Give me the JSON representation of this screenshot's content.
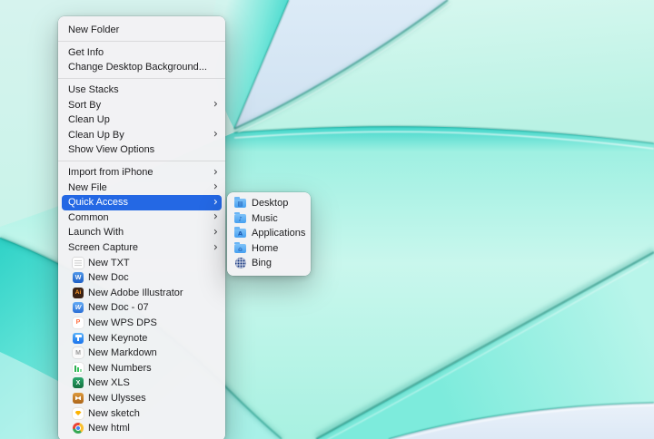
{
  "colors": {
    "menu_highlight": "#2468e4",
    "menu_background": "#f3f2f4",
    "menu_text": "#1d1d1f",
    "wallpaper_mint": "#c6f2e7",
    "wallpaper_cyan": "#2fd3c8",
    "wallpaper_pale_blue": "#d9e7f5",
    "wallpaper_edge_teal": "#0b8172"
  },
  "glyphs": {
    "submenu_chevron": "›"
  },
  "icon_glyphs": {
    "word-doc-icon": "W",
    "adobe-illustrator-icon": "Ai",
    "wps-writer-icon": "W",
    "wps-dps-icon": "P",
    "markdown-icon": "M",
    "excel-icon": "X",
    "desktop-folder-icon": "▤",
    "music-folder-icon": "♪",
    "applications-folder-icon": "A",
    "home-folder-icon": "⌂"
  },
  "context_menu": {
    "items": [
      {
        "label": "New Folder"
      },
      {
        "type": "separator"
      },
      {
        "label": "Get Info"
      },
      {
        "label": "Change Desktop Background..."
      },
      {
        "type": "separator"
      },
      {
        "label": "Use Stacks"
      },
      {
        "label": "Sort By",
        "submenu_arrow": true
      },
      {
        "label": "Clean Up"
      },
      {
        "label": "Clean Up By",
        "submenu_arrow": true
      },
      {
        "label": "Show View Options"
      },
      {
        "type": "separator"
      },
      {
        "label": "Import from iPhone",
        "submenu_arrow": true
      },
      {
        "label": "New File",
        "submenu_arrow": true
      },
      {
        "label": "Quick Access",
        "submenu_arrow": true,
        "highlighted": true
      },
      {
        "label": "Common",
        "submenu_arrow": true
      },
      {
        "label": "Launch With",
        "submenu_arrow": true
      },
      {
        "label": "Screen Capture",
        "submenu_arrow": true
      },
      {
        "label": "New TXT",
        "icon": "txt-file-icon"
      },
      {
        "label": "New Doc",
        "icon": "word-doc-icon"
      },
      {
        "label": "New Adobe Illustrator",
        "icon": "adobe-illustrator-icon"
      },
      {
        "label": "New Doc - 07",
        "icon": "wps-writer-icon"
      },
      {
        "label": "New WPS DPS",
        "icon": "wps-dps-icon"
      },
      {
        "label": "New Keynote",
        "icon": "keynote-icon"
      },
      {
        "label": "New Markdown",
        "icon": "markdown-icon"
      },
      {
        "label": "New Numbers",
        "icon": "numbers-icon"
      },
      {
        "label": "New XLS",
        "icon": "excel-icon"
      },
      {
        "label": "New Ulysses",
        "icon": "ulysses-icon"
      },
      {
        "label": "New sketch",
        "icon": "sketch-icon"
      },
      {
        "label": "New html",
        "icon": "html-chrome-icon"
      }
    ]
  },
  "quick_access_submenu": {
    "items": [
      {
        "label": "Desktop",
        "icon": "desktop-folder-icon",
        "icon_kind": "folder"
      },
      {
        "label": "Music",
        "icon": "music-folder-icon",
        "icon_kind": "folder"
      },
      {
        "label": "Applications",
        "icon": "applications-folder-icon",
        "icon_kind": "folder"
      },
      {
        "label": "Home",
        "icon": "home-folder-icon",
        "icon_kind": "folder"
      },
      {
        "label": "Bing",
        "icon": "bing-globe-icon",
        "icon_kind": "globe"
      }
    ]
  }
}
